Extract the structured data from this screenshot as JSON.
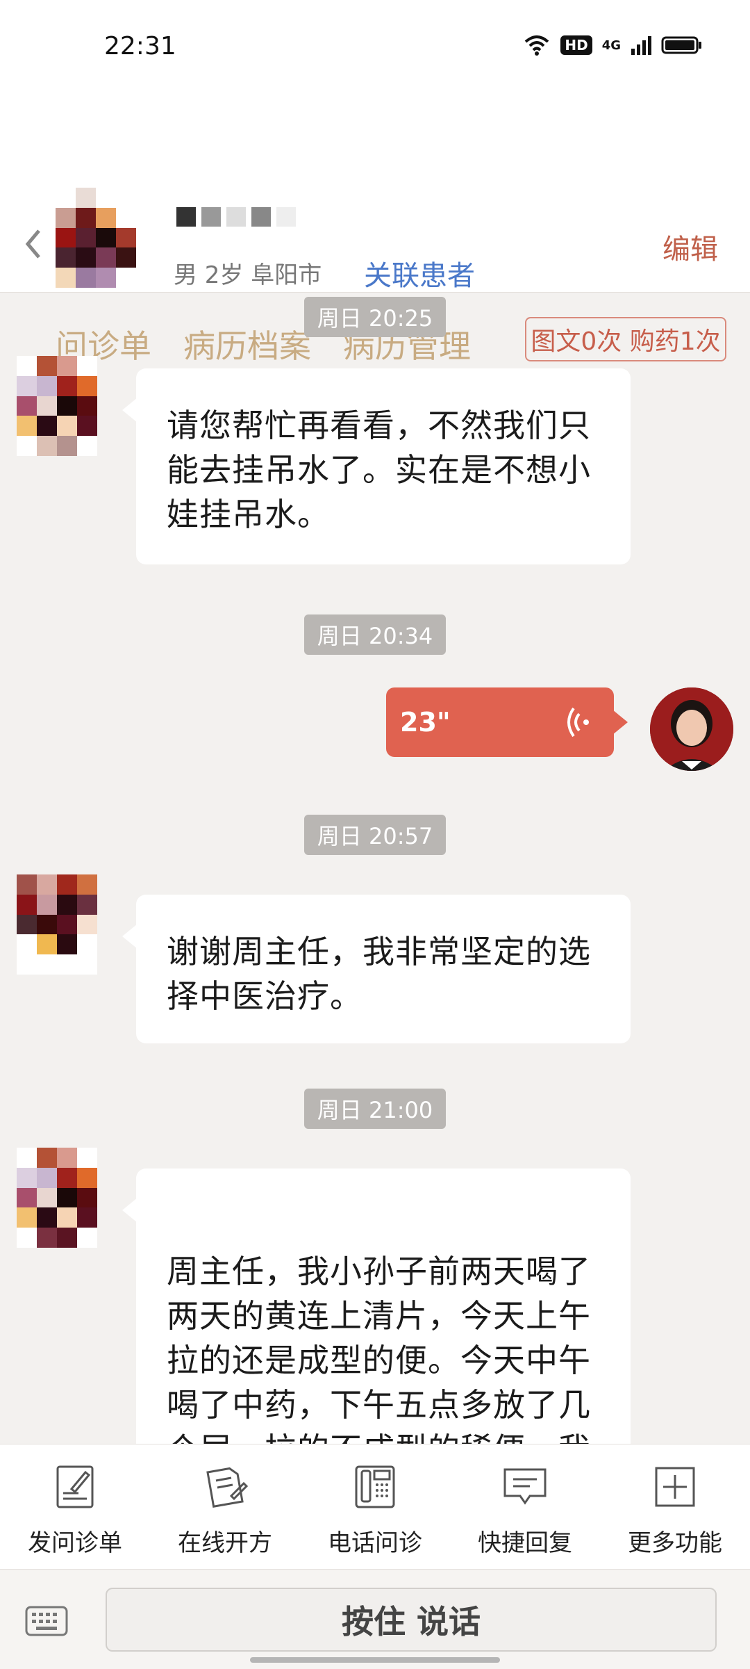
{
  "status_bar": {
    "time": "22:31",
    "hd": "HD",
    "network": "4G"
  },
  "header": {
    "patient_meta": "男 2岁  阜阳市",
    "link_patient": "关联患者",
    "edit": "编辑",
    "tabs": [
      "问诊单",
      "病历档案",
      "病历管理"
    ],
    "quota": "图文0次 购药1次"
  },
  "chat": {
    "messages": [
      {
        "timestamp": "周日 20:25",
        "text": "请您帮忙再看看，不然我们只能去挂吊水了。实在是不想小娃挂吊水。"
      },
      {
        "timestamp": "周日 20:34",
        "voice_duration": "23\""
      },
      {
        "timestamp": "周日 20:57",
        "text": "谢谢周主任，我非常坚定的选择中医治疗。"
      },
      {
        "timestamp": "周日 21:00",
        "text": "周主任，我小孙子前两天喝了两天的黄连上清片，今天上午拉的还是成型的便。今天中午喝了中药，下午五点多放了几个屁，拉的不成型的稀便，我"
      }
    ]
  },
  "function_bar": {
    "items": [
      {
        "label": "发问诊单",
        "icon": "form-pen-icon"
      },
      {
        "label": "在线开方",
        "icon": "prescription-icon"
      },
      {
        "label": "电话问诊",
        "icon": "phone-icon"
      },
      {
        "label": "快捷回复",
        "icon": "chat-reply-icon"
      },
      {
        "label": "更多功能",
        "icon": "plus-square-icon"
      }
    ]
  },
  "input_bar": {
    "talk_button": "按住 说话"
  },
  "colors": {
    "accent_red": "#e06250",
    "link_blue": "#4a78c9",
    "tab_gold": "#c8ab82"
  }
}
